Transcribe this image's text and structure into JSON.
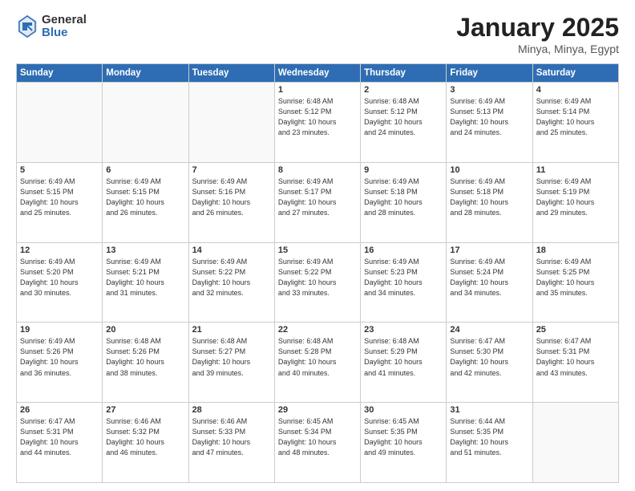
{
  "logo": {
    "general": "General",
    "blue": "Blue"
  },
  "title": {
    "month": "January 2025",
    "location": "Minya, Minya, Egypt"
  },
  "weekdays": [
    "Sunday",
    "Monday",
    "Tuesday",
    "Wednesday",
    "Thursday",
    "Friday",
    "Saturday"
  ],
  "weeks": [
    [
      {
        "day": "",
        "info": ""
      },
      {
        "day": "",
        "info": ""
      },
      {
        "day": "",
        "info": ""
      },
      {
        "day": "1",
        "info": "Sunrise: 6:48 AM\nSunset: 5:12 PM\nDaylight: 10 hours\nand 23 minutes."
      },
      {
        "day": "2",
        "info": "Sunrise: 6:48 AM\nSunset: 5:12 PM\nDaylight: 10 hours\nand 24 minutes."
      },
      {
        "day": "3",
        "info": "Sunrise: 6:49 AM\nSunset: 5:13 PM\nDaylight: 10 hours\nand 24 minutes."
      },
      {
        "day": "4",
        "info": "Sunrise: 6:49 AM\nSunset: 5:14 PM\nDaylight: 10 hours\nand 25 minutes."
      }
    ],
    [
      {
        "day": "5",
        "info": "Sunrise: 6:49 AM\nSunset: 5:15 PM\nDaylight: 10 hours\nand 25 minutes."
      },
      {
        "day": "6",
        "info": "Sunrise: 6:49 AM\nSunset: 5:15 PM\nDaylight: 10 hours\nand 26 minutes."
      },
      {
        "day": "7",
        "info": "Sunrise: 6:49 AM\nSunset: 5:16 PM\nDaylight: 10 hours\nand 26 minutes."
      },
      {
        "day": "8",
        "info": "Sunrise: 6:49 AM\nSunset: 5:17 PM\nDaylight: 10 hours\nand 27 minutes."
      },
      {
        "day": "9",
        "info": "Sunrise: 6:49 AM\nSunset: 5:18 PM\nDaylight: 10 hours\nand 28 minutes."
      },
      {
        "day": "10",
        "info": "Sunrise: 6:49 AM\nSunset: 5:18 PM\nDaylight: 10 hours\nand 28 minutes."
      },
      {
        "day": "11",
        "info": "Sunrise: 6:49 AM\nSunset: 5:19 PM\nDaylight: 10 hours\nand 29 minutes."
      }
    ],
    [
      {
        "day": "12",
        "info": "Sunrise: 6:49 AM\nSunset: 5:20 PM\nDaylight: 10 hours\nand 30 minutes."
      },
      {
        "day": "13",
        "info": "Sunrise: 6:49 AM\nSunset: 5:21 PM\nDaylight: 10 hours\nand 31 minutes."
      },
      {
        "day": "14",
        "info": "Sunrise: 6:49 AM\nSunset: 5:22 PM\nDaylight: 10 hours\nand 32 minutes."
      },
      {
        "day": "15",
        "info": "Sunrise: 6:49 AM\nSunset: 5:22 PM\nDaylight: 10 hours\nand 33 minutes."
      },
      {
        "day": "16",
        "info": "Sunrise: 6:49 AM\nSunset: 5:23 PM\nDaylight: 10 hours\nand 34 minutes."
      },
      {
        "day": "17",
        "info": "Sunrise: 6:49 AM\nSunset: 5:24 PM\nDaylight: 10 hours\nand 34 minutes."
      },
      {
        "day": "18",
        "info": "Sunrise: 6:49 AM\nSunset: 5:25 PM\nDaylight: 10 hours\nand 35 minutes."
      }
    ],
    [
      {
        "day": "19",
        "info": "Sunrise: 6:49 AM\nSunset: 5:26 PM\nDaylight: 10 hours\nand 36 minutes."
      },
      {
        "day": "20",
        "info": "Sunrise: 6:48 AM\nSunset: 5:26 PM\nDaylight: 10 hours\nand 38 minutes."
      },
      {
        "day": "21",
        "info": "Sunrise: 6:48 AM\nSunset: 5:27 PM\nDaylight: 10 hours\nand 39 minutes."
      },
      {
        "day": "22",
        "info": "Sunrise: 6:48 AM\nSunset: 5:28 PM\nDaylight: 10 hours\nand 40 minutes."
      },
      {
        "day": "23",
        "info": "Sunrise: 6:48 AM\nSunset: 5:29 PM\nDaylight: 10 hours\nand 41 minutes."
      },
      {
        "day": "24",
        "info": "Sunrise: 6:47 AM\nSunset: 5:30 PM\nDaylight: 10 hours\nand 42 minutes."
      },
      {
        "day": "25",
        "info": "Sunrise: 6:47 AM\nSunset: 5:31 PM\nDaylight: 10 hours\nand 43 minutes."
      }
    ],
    [
      {
        "day": "26",
        "info": "Sunrise: 6:47 AM\nSunset: 5:31 PM\nDaylight: 10 hours\nand 44 minutes."
      },
      {
        "day": "27",
        "info": "Sunrise: 6:46 AM\nSunset: 5:32 PM\nDaylight: 10 hours\nand 46 minutes."
      },
      {
        "day": "28",
        "info": "Sunrise: 6:46 AM\nSunset: 5:33 PM\nDaylight: 10 hours\nand 47 minutes."
      },
      {
        "day": "29",
        "info": "Sunrise: 6:45 AM\nSunset: 5:34 PM\nDaylight: 10 hours\nand 48 minutes."
      },
      {
        "day": "30",
        "info": "Sunrise: 6:45 AM\nSunset: 5:35 PM\nDaylight: 10 hours\nand 49 minutes."
      },
      {
        "day": "31",
        "info": "Sunrise: 6:44 AM\nSunset: 5:35 PM\nDaylight: 10 hours\nand 51 minutes."
      },
      {
        "day": "",
        "info": ""
      }
    ]
  ]
}
